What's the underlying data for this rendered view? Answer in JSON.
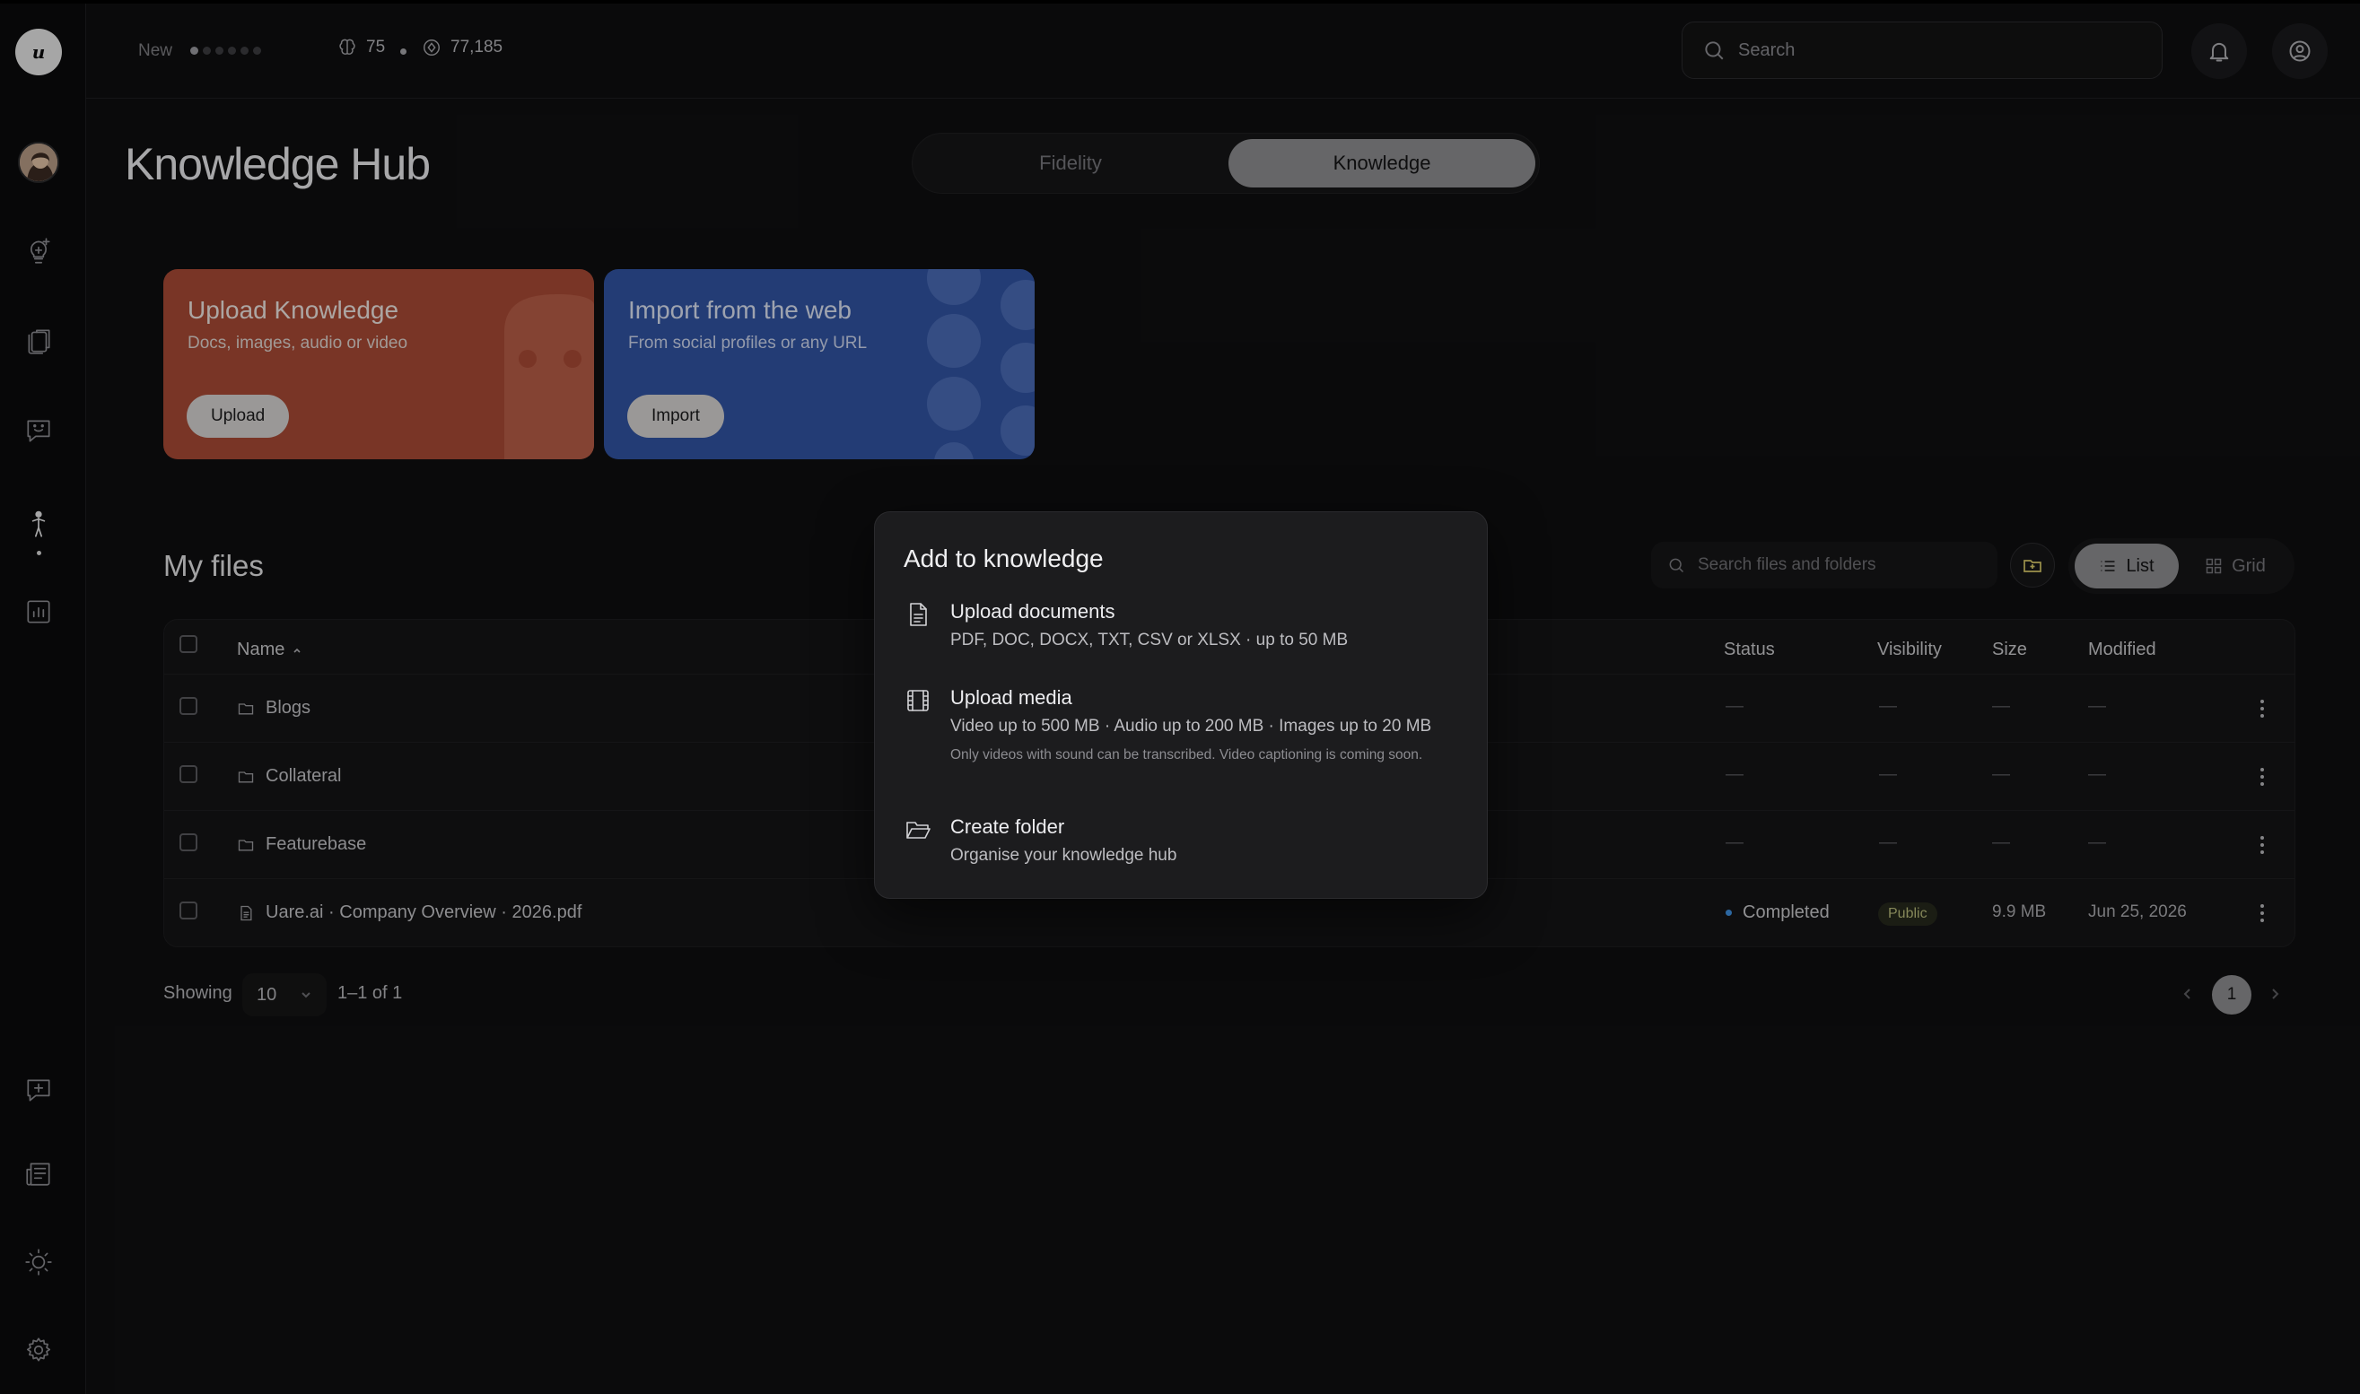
{
  "topbar": {
    "new_label": "New",
    "stat_a": "75",
    "stat_b": "77,185",
    "search_placeholder": "Search"
  },
  "header": {
    "title": "Knowledge Hub",
    "tabs": [
      "Fidelity",
      "Knowledge"
    ],
    "active_tab": "Knowledge"
  },
  "cards": {
    "upload": {
      "title": "Upload Knowledge",
      "subtitle": "Docs, images, audio or video",
      "button": "Upload",
      "color": "#a84a35"
    },
    "import": {
      "title": "Import from the web",
      "subtitle": "From social profiles or any URL",
      "button": "Import",
      "color": "#3154a2"
    }
  },
  "files": {
    "title": "My files",
    "search_placeholder": "Search files and folders",
    "view_list": "List",
    "view_grid": "Grid",
    "columns": {
      "name": "Name",
      "status": "Status",
      "visibility": "Visibility",
      "size": "Size",
      "modified": "Modified"
    },
    "dash": "—",
    "rows": [
      {
        "type": "folder",
        "name": "Blogs"
      },
      {
        "type": "folder",
        "name": "Collateral"
      },
      {
        "type": "folder",
        "name": "Featurebase"
      },
      {
        "type": "file",
        "name": "Uare.ai · Company Overview · 2026.pdf",
        "status": "Completed",
        "visibility": "Public",
        "size": "9.9 MB",
        "modified": "Jun 25, 2026"
      }
    ]
  },
  "pagination": {
    "showing_label": "Showing",
    "page_size": "10",
    "range": "1–1 of 1",
    "current_page": "1"
  },
  "popover": {
    "title": "Add to knowledge",
    "items": [
      {
        "icon": "document-icon",
        "title": "Upload documents",
        "desc": "PDF, DOC, DOCX, TXT, CSV or XLSX · up to 50 MB"
      },
      {
        "icon": "film-icon",
        "title": "Upload media",
        "desc": "Video up to 500 MB · Audio up to 200 MB · Images up to 20 MB",
        "note": "Only videos with sound can be transcribed. Video captioning is coming soon."
      },
      {
        "icon": "folder-open-icon",
        "title": "Create folder",
        "desc": "Organise your knowledge hub"
      }
    ]
  },
  "sidebar": {
    "icons": [
      "lightbulb-plus-icon",
      "library-icon",
      "chat-face-icon",
      "person-icon",
      "analytics-icon",
      "chat-plus-icon",
      "news-icon",
      "sun-icon",
      "gear-icon"
    ]
  },
  "colors": {
    "status_dot": "#3e8fe0",
    "accent_pill": "#8e8e90"
  }
}
